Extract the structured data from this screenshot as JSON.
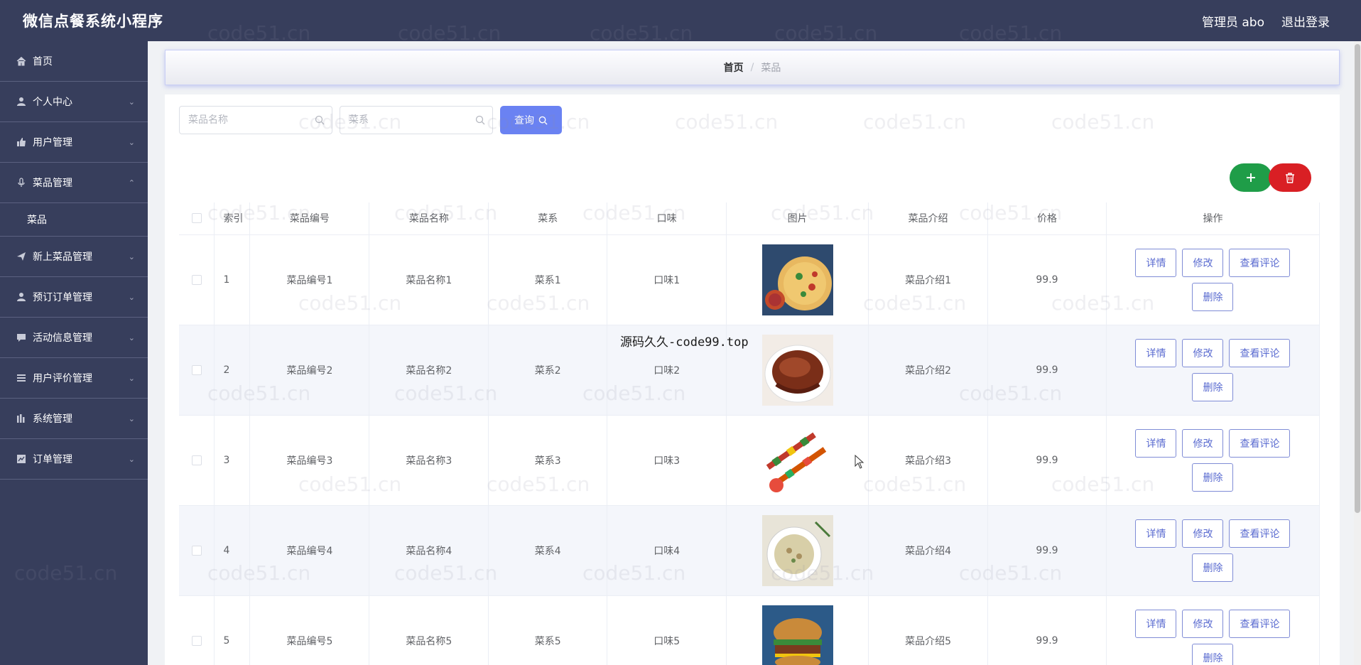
{
  "header": {
    "title": "微信点餐系统小程序",
    "user": "管理员 abo",
    "logout": "退出登录"
  },
  "sidebar": {
    "items": [
      {
        "label": "首页",
        "icon": "home-icon",
        "expandable": false
      },
      {
        "label": "个人中心",
        "icon": "user-icon",
        "expandable": true
      },
      {
        "label": "用户管理",
        "icon": "thumb-icon",
        "expandable": true
      },
      {
        "label": "菜品管理",
        "icon": "mic-icon",
        "expandable": true,
        "expanded": true,
        "children": [
          "菜品"
        ]
      },
      {
        "label": "新上菜品管理",
        "icon": "send-icon",
        "expandable": true
      },
      {
        "label": "预订订单管理",
        "icon": "user-icon",
        "expandable": true
      },
      {
        "label": "活动信息管理",
        "icon": "message-icon",
        "expandable": true
      },
      {
        "label": "用户评价管理",
        "icon": "list-icon",
        "expandable": true
      },
      {
        "label": "系统管理",
        "icon": "bar-chart-icon",
        "expandable": true
      },
      {
        "label": "订单管理",
        "icon": "trend-icon",
        "expandable": true
      }
    ]
  },
  "breadcrumb": {
    "home": "首页",
    "separator": "/",
    "current": "菜品"
  },
  "search": {
    "name_placeholder": "菜品名称",
    "category_placeholder": "菜系",
    "query_label": "查询"
  },
  "table": {
    "headers": [
      "索引",
      "菜品编号",
      "菜品名称",
      "菜系",
      "口味",
      "图片",
      "菜品介绍",
      "价格",
      "操作"
    ],
    "rows": [
      {
        "index": "1",
        "code": "菜品编号1",
        "name": "菜品名称1",
        "category": "菜系1",
        "taste": "口味1",
        "image": "pizza-image",
        "intro": "菜品介绍1",
        "price": "99.9"
      },
      {
        "index": "2",
        "code": "菜品编号2",
        "name": "菜品名称2",
        "category": "菜系2",
        "taste": "口味2",
        "image": "braised-meat-image",
        "intro": "菜品介绍2",
        "price": "99.9"
      },
      {
        "index": "3",
        "code": "菜品编号3",
        "name": "菜品名称3",
        "category": "菜系3",
        "taste": "口味3",
        "image": "skewers-image",
        "intro": "菜品介绍3",
        "price": "99.9"
      },
      {
        "index": "4",
        "code": "菜品编号4",
        "name": "菜品名称4",
        "category": "菜系4",
        "taste": "口味4",
        "image": "soup-image",
        "intro": "菜品介绍4",
        "price": "99.9"
      },
      {
        "index": "5",
        "code": "菜品编号5",
        "name": "菜品名称5",
        "category": "菜系5",
        "taste": "口味5",
        "image": "burger-image",
        "intro": "菜品介绍5",
        "price": "99.9"
      }
    ],
    "actions": {
      "detail": "详情",
      "edit": "修改",
      "comments": "查看评论",
      "delete": "删除"
    }
  },
  "watermark": {
    "text": "code51.cn",
    "overlay": "源码久久-code99.top"
  },
  "colors": {
    "sidebar": "#373e5c",
    "primary": "#6a82f2",
    "add": "#1f9d48",
    "delete": "#d91f24"
  }
}
